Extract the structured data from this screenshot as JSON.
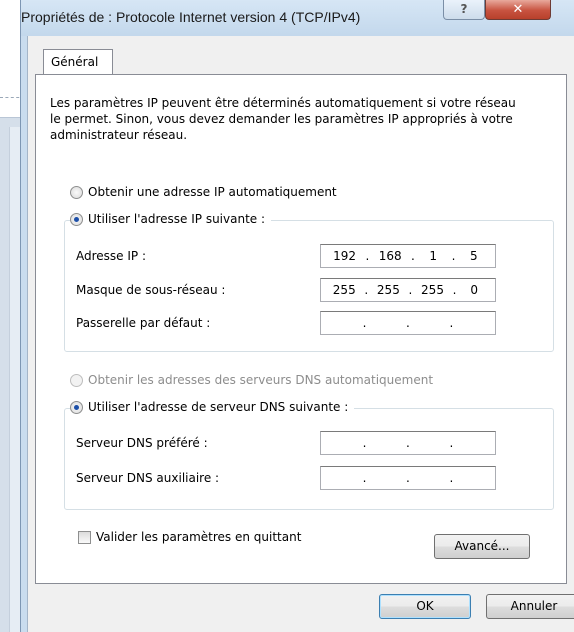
{
  "window": {
    "title": "Propriétés de : Protocole Internet version 4 (TCP/IPv4)",
    "help_glyph": "?",
    "close_glyph": "✕"
  },
  "tabs": [
    {
      "label": "Général"
    }
  ],
  "intro_text": "Les paramètres IP peuvent être déterminés automatiquement si votre réseau le permet. Sinon, vous devez demander les paramètres IP appropriés à votre administrateur réseau.",
  "ip_mode": {
    "auto_label": "Obtenir une adresse IP automatiquement",
    "manual_label": "Utiliser l'adresse IP suivante :",
    "selected": "manual"
  },
  "ip_fields": {
    "address": {
      "label": "Adresse IP :",
      "octets": [
        "192",
        "168",
        "1",
        "5"
      ]
    },
    "mask": {
      "label": "Masque de sous-réseau :",
      "octets": [
        "255",
        "255",
        "255",
        "0"
      ]
    },
    "gateway": {
      "label": "Passerelle par défaut :",
      "octets": [
        "",
        "",
        "",
        ""
      ]
    }
  },
  "dns_mode": {
    "auto_label": "Obtenir les adresses des serveurs DNS automatiquement",
    "manual_label": "Utiliser l'adresse de serveur DNS suivante :",
    "selected": "manual",
    "auto_disabled": true
  },
  "dns_fields": {
    "preferred": {
      "label": "Serveur DNS préféré :",
      "octets": [
        "",
        "",
        "",
        ""
      ]
    },
    "alternate": {
      "label": "Serveur DNS auxiliaire :",
      "octets": [
        "",
        "",
        "",
        ""
      ]
    }
  },
  "validate_on_exit": {
    "label": "Valider les paramètres en quittant",
    "checked": false
  },
  "buttons": {
    "advanced": "Avancé...",
    "ok": "OK",
    "cancel": "Annuler"
  },
  "colors": {
    "title_bar": "#c9dcee",
    "close_button": "#c85340",
    "dialog_face": "#f0f0f0",
    "radio_dot": "#1d4fa8"
  }
}
